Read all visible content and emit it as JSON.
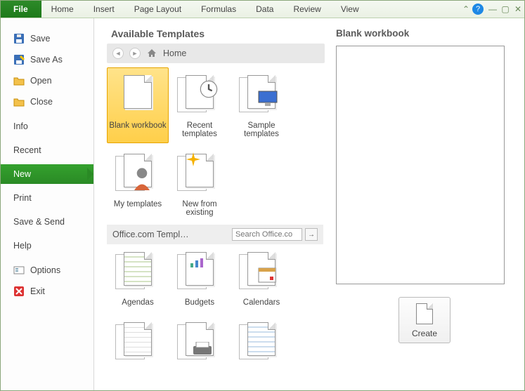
{
  "ribbon": {
    "file": "File",
    "tabs": [
      "Home",
      "Insert",
      "Page Layout",
      "Formulas",
      "Data",
      "Review",
      "View"
    ]
  },
  "sidebar": {
    "items": [
      {
        "label": "Save",
        "icon": "save"
      },
      {
        "label": "Save As",
        "icon": "saveas"
      },
      {
        "label": "Open",
        "icon": "open"
      },
      {
        "label": "Close",
        "icon": "close"
      },
      {
        "label": "Info"
      },
      {
        "label": "Recent"
      },
      {
        "label": "New",
        "active": true
      },
      {
        "label": "Print"
      },
      {
        "label": "Save & Send"
      },
      {
        "label": "Help"
      },
      {
        "label": "Options",
        "icon": "options"
      },
      {
        "label": "Exit",
        "icon": "exit"
      }
    ]
  },
  "templates": {
    "heading": "Available Templates",
    "breadcrumb_home": "Home",
    "items_local": [
      {
        "label": "Blank workbook",
        "selected": true,
        "kind": "blank"
      },
      {
        "label": "Recent templates",
        "kind": "recent"
      },
      {
        "label": "Sample templates",
        "kind": "sample"
      },
      {
        "label": "My templates",
        "kind": "my"
      },
      {
        "label": "New from existing",
        "kind": "newfrom"
      }
    ],
    "office_section_label": "Office.com Templ…",
    "search_placeholder": "Search Office.co",
    "items_office": [
      {
        "label": "Agendas"
      },
      {
        "label": "Budgets"
      },
      {
        "label": "Calendars"
      }
    ]
  },
  "preview": {
    "title": "Blank workbook",
    "create_label": "Create"
  }
}
